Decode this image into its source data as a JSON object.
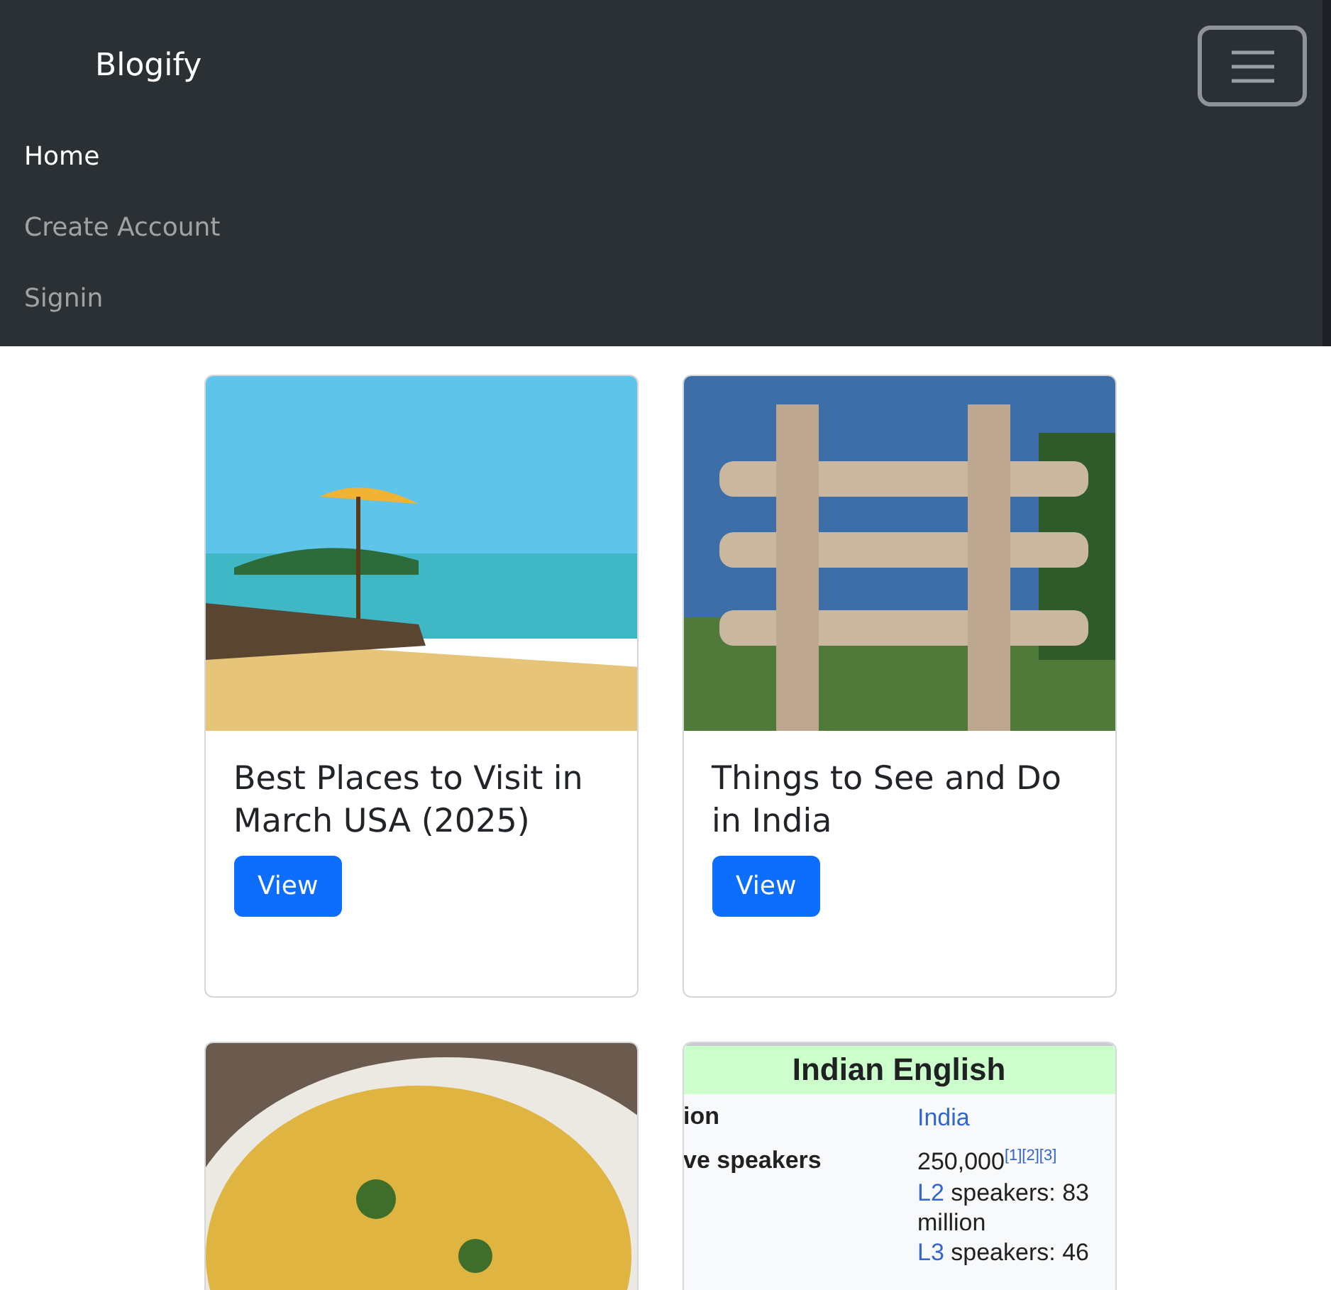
{
  "navbar": {
    "brand": "Blogify",
    "links": [
      {
        "label": "Home",
        "selected": true
      },
      {
        "label": "Create Account",
        "selected": false
      },
      {
        "label": "Signin",
        "selected": false
      }
    ]
  },
  "cards": [
    {
      "image": {
        "kind": "beach"
      },
      "title": "Best Places to Visit in March USA (2025)",
      "button": "View"
    },
    {
      "image": {
        "kind": "gateway"
      },
      "title": "Things to See and Do in India",
      "button": "View"
    },
    {
      "image": {
        "kind": "food"
      }
    },
    {
      "image": {
        "kind": "infobox",
        "title": "Indian English",
        "rows": [
          {
            "label": "ion",
            "lines": [
              [
                {
                  "text": "India",
                  "link": true
                }
              ]
            ]
          },
          {
            "label": "ve speakers",
            "lines": [
              [
                {
                  "text": "250,000$^{[1][2][3]}$",
                  "link": false
                }
              ],
              [
                {
                  "text": "L2",
                  "link": true
                },
                {
                  "text": " speakers: 83 million",
                  "link": false
                }
              ],
              [
                {
                  "text": "L3",
                  "link": true
                },
                {
                  "text": " speakers: 46",
                  "link": false
                }
              ]
            ]
          }
        ]
      }
    }
  ]
}
